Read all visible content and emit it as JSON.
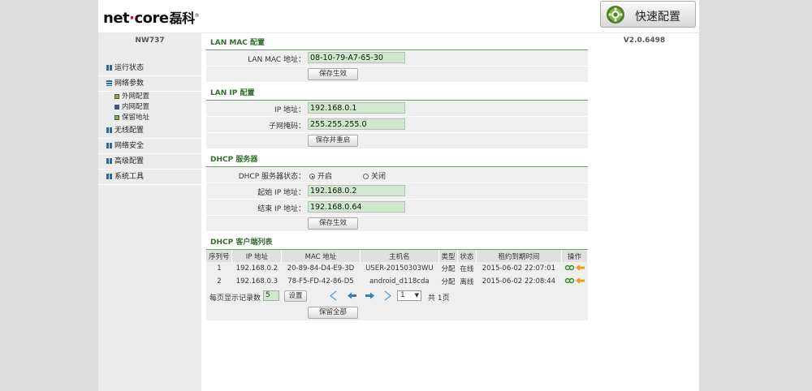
{
  "header": {
    "brand_en_a": "net",
    "brand_dot": "·",
    "brand_en_b": "core",
    "brand_cn": "磊科",
    "brand_reg": "®",
    "quick_label": "快速配置"
  },
  "sidebar": {
    "model": "NW737",
    "items": [
      {
        "label": "运行状态"
      },
      {
        "label": "网络参数"
      },
      {
        "label": "无线配置"
      },
      {
        "label": "网络安全"
      },
      {
        "label": "高级配置"
      },
      {
        "label": "系统工具"
      }
    ],
    "subitems": [
      {
        "label": "外网配置"
      },
      {
        "label": "内网配置"
      },
      {
        "label": "保留地址"
      }
    ]
  },
  "version": "V2.0.6498",
  "lan_mac": {
    "title": "LAN MAC 配置",
    "label": "LAN MAC 地址：",
    "value": "08-10-79-A7-65-30",
    "save": "保存生效"
  },
  "lan_ip": {
    "title": "LAN IP 配置",
    "ip_label": "IP 地址：",
    "ip_value": "192.168.0.1",
    "mask_label": "子网掩码：",
    "mask_value": "255.255.255.0",
    "save": "保存并重启"
  },
  "dhcp": {
    "title": "DHCP 服务器",
    "state_label": "DHCP 服务器状态：",
    "on": "开启",
    "off": "关闭",
    "start_label": "起始 IP 地址：",
    "start_value": "192.168.0.2",
    "end_label": "结束 IP 地址：",
    "end_value": "192.168.0.64",
    "save": "保存生效"
  },
  "clients": {
    "title": "DHCP 客户端列表",
    "columns": [
      "序列号",
      "IP 地址",
      "MAC 地址",
      "主机名",
      "类型",
      "状态",
      "租约到期时间",
      "操作"
    ],
    "rows": [
      [
        "1",
        "192.168.0.2",
        "20-89-84-D4-E9-3D",
        "USER-20150303WU",
        "分配",
        "在线",
        "2015-06-02 22:07:01"
      ],
      [
        "2",
        "192.168.0.3",
        "78-F5-FD-42-86-D5",
        "android_d118cda",
        "分配",
        "离线",
        "2015-06-02 22:08:44"
      ]
    ],
    "per_page_label": "每页显示记录数",
    "per_page_value": "5",
    "set": "设置",
    "page_value": "1",
    "total": "共 1页",
    "save_all": "保留全部"
  },
  "colors": {
    "accent_green": "#336e2b",
    "field_bg": "#cfe9cf"
  }
}
